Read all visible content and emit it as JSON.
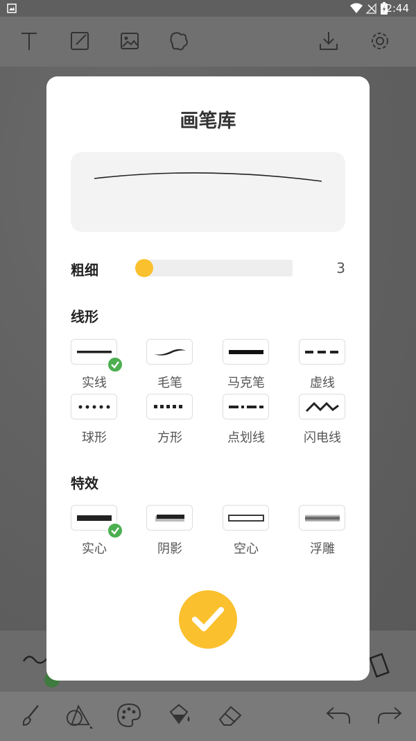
{
  "status_bar": {
    "time": "2:44"
  },
  "toolbar": {
    "icons": [
      "text-icon",
      "edit-icon",
      "image-icon",
      "shape-icon",
      "download-icon",
      "settings-icon"
    ]
  },
  "bottom_bar": {
    "icons": [
      "brush-icon",
      "shape-fill-icon",
      "palette-icon",
      "paint-bucket-icon",
      "eraser-icon",
      "undo-icon",
      "redo-icon"
    ]
  },
  "dialog": {
    "title": "画笔库",
    "thickness": {
      "label": "粗细",
      "value": "3",
      "level": 0.0
    },
    "line_shape": {
      "label": "线形",
      "options": [
        {
          "label": "实线",
          "selected": true
        },
        {
          "label": "毛笔",
          "selected": false
        },
        {
          "label": "马克笔",
          "selected": false
        },
        {
          "label": "虚线",
          "selected": false
        },
        {
          "label": "球形",
          "selected": false
        },
        {
          "label": "方形",
          "selected": false
        },
        {
          "label": "点划线",
          "selected": false
        },
        {
          "label": "闪电线",
          "selected": false
        }
      ]
    },
    "effects": {
      "label": "特效",
      "options": [
        {
          "label": "实心",
          "selected": true
        },
        {
          "label": "阴影",
          "selected": false
        },
        {
          "label": "空心",
          "selected": false
        },
        {
          "label": "浮雕",
          "selected": false
        }
      ]
    }
  },
  "colors": {
    "accent": "#fbc02d",
    "check": "#4caf50"
  }
}
